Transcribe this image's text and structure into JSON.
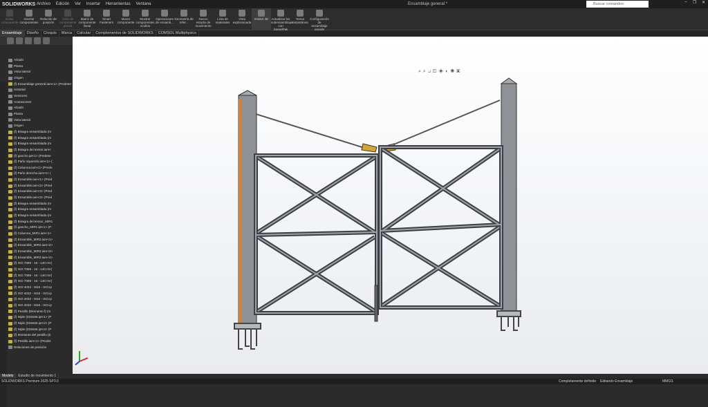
{
  "titlebar": {
    "logo": "SOLIDWORKS",
    "menu": [
      "Archivo",
      "Edición",
      "Ver",
      "Insertar",
      "Herramientas",
      "Ventana"
    ],
    "doc_title": "Ensamblaje general *",
    "search_placeholder": "Buscar comandos"
  },
  "ribbon": [
    {
      "label": "Editar componente",
      "disabled": true
    },
    {
      "label": "Insertar componentes"
    },
    {
      "label": "Relación de posición"
    },
    {
      "label": "Vista de componente previa",
      "disabled": true
    },
    {
      "label": "Matriz de componente lineal"
    },
    {
      "label": "Smart Fasteners"
    },
    {
      "label": "Mover componente"
    },
    {
      "label": "Mostrar componentes ocultos"
    },
    {
      "label": "Operaciones de ensamb..."
    },
    {
      "label": "Geometría de refer..."
    },
    {
      "label": "Nuevo estudio de movimiento"
    },
    {
      "label": "Lista de materiales"
    },
    {
      "label": "Vista explosionada"
    },
    {
      "label": "Instant 3D",
      "active": true
    },
    {
      "label": "Actualizar los subensamblajes con SpeedPak"
    },
    {
      "label": "Tomar instantánea"
    },
    {
      "label": "Configuración de ensamblaje grande"
    }
  ],
  "tabs": [
    "Ensamblaje",
    "Diseño",
    "Croquis",
    "Marca",
    "Calcular",
    "Complementos de SOLIDWORKS",
    "COMSOL Multiphysics"
  ],
  "tree": [
    {
      "label": "Alzado",
      "plain": true
    },
    {
      "label": "Planta",
      "plain": true
    },
    {
      "label": "Vista lateral",
      "plain": true
    },
    {
      "label": "Origen",
      "plain": true
    },
    {
      "label": "(f) Ensamblaje general.iam<1> (Predeter"
    },
    {
      "label": "Historial",
      "plain": true
    },
    {
      "label": "Sensores",
      "plain": true
    },
    {
      "label": "Anotaciones",
      "plain": true
    },
    {
      "label": "Alzado",
      "plain": true
    },
    {
      "label": "Planta",
      "plain": true
    },
    {
      "label": "Vista lateral",
      "plain": true
    },
    {
      "label": "Origen",
      "plain": true
    },
    {
      "label": "(f) Bisagra ensamblada (m"
    },
    {
      "label": "(f) Bisagra ensamblada (m"
    },
    {
      "label": "(f) Bisagra ensamblada (m"
    },
    {
      "label": "(f) Bisagra del tensor.iam<"
    },
    {
      "label": "(f) gancho.ipt<1> (Predete"
    },
    {
      "label": "(f) Paño izquierdo.iam<1> ("
    },
    {
      "label": "(f) Columna.iam<1> (Prede"
    },
    {
      "label": "(f) Paño derecho.iam<1> ("
    },
    {
      "label": "(f) Ensamble.iam<1> (Pred"
    },
    {
      "label": "(f) Ensamble.iam<2> (Pred"
    },
    {
      "label": "(f) Ensamble.iam<3> (Pred"
    },
    {
      "label": "(f) Ensamble.iam<4> (Pred"
    },
    {
      "label": "(f) Bisagra ensamblada (m"
    },
    {
      "label": "(f) Bisagra ensamblada (m"
    },
    {
      "label": "(f) Bisagra ensamblada (m"
    },
    {
      "label": "(f) Bisagra del tensor_MIR1"
    },
    {
      "label": "(f) gancho_MIR1.ipt<1> (P"
    },
    {
      "label": "(f) Columna_MIR1.iam<1>"
    },
    {
      "label": "(f) Ensamble_MIR2.iam<1>"
    },
    {
      "label": "(f) Ensamble_MIR2.iam<2>"
    },
    {
      "label": "(f) Ensamble_MIR2.iam<3>"
    },
    {
      "label": "(f) Ensamble_MIR2.iam<4>"
    },
    {
      "label": "(f) ISO 7089 - 16 - 140 HV("
    },
    {
      "label": "(f) ISO 7089 - 16 - 140 HV("
    },
    {
      "label": "(f) ISO 7089 - 16 - 140 HV("
    },
    {
      "label": "(f) ISO 7089 - 16 - 140 HV("
    },
    {
      "label": "(f) ISO 4032 - M16 - ISO.ip"
    },
    {
      "label": "(f) ISO 4032 - M16 - ISO.ip"
    },
    {
      "label": "(f) ISO 4032 - M16 - ISO.ip"
    },
    {
      "label": "(f) ISO 4032 - M16 - ISO.ip"
    },
    {
      "label": "(f) Pestillo (Elemento f) (m"
    },
    {
      "label": "(f) Niple (02Ss55.ipt<1> (P"
    },
    {
      "label": "(f) Niple (02Ss55.ipt<2> (P"
    },
    {
      "label": "(f) Niple (02Ss55.ipt<3> (P"
    },
    {
      "label": "(f) Montante del pestillo (E"
    },
    {
      "label": "(f) Pestillo.iam<1> (Predet"
    },
    {
      "label": "Relaciones de posición",
      "plain": true
    }
  ],
  "bottom_tree_label": "Relaciones de posición",
  "bottom_tabs": [
    "Modelo",
    "Estudio de movimiento 1"
  ],
  "status": {
    "app": "SOLIDWORKS Premium 2025 SP3.0",
    "state": "Completamente definido",
    "mode": "Editando Ensamblaje",
    "units": "MMGS"
  }
}
